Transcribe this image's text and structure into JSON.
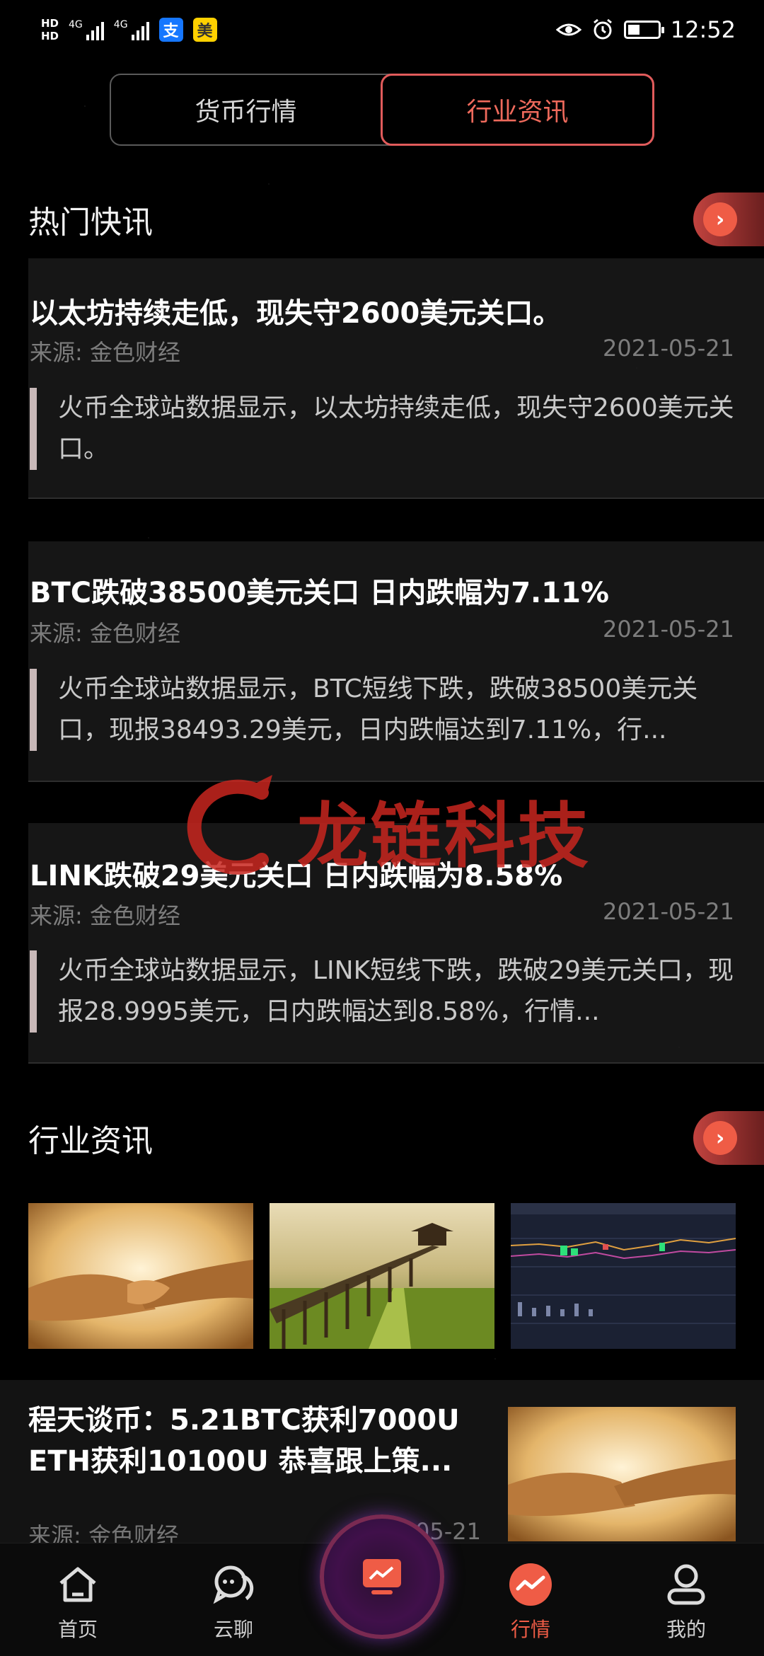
{
  "status_bar": {
    "hd1": "HD",
    "hd2": "HD",
    "net1": "4G",
    "net2": "4G",
    "app1": "支",
    "app2": "美",
    "time": "12:52",
    "battery_level": 0.4
  },
  "tabs": [
    {
      "label": "货币行情",
      "active": false
    },
    {
      "label": "行业资讯",
      "active": true
    }
  ],
  "hot_news": {
    "title": "热门快讯",
    "items": [
      {
        "title": "以太坊持续走低，现失守2600美元关口。",
        "source": "来源: 金色财经",
        "date": "2021-05-21",
        "summary": "火币全球站数据显示，以太坊持续走低，现失守2600美元关口。"
      },
      {
        "title": "BTC跌破38500美元关口 日内跌幅为7.11%",
        "source": "来源: 金色财经",
        "date": "2021-05-21",
        "summary": "火币全球站数据显示，BTC短线下跌，跌破38500美元关口，现报38493.29美元，日内跌幅达到7.11%，行..."
      },
      {
        "title": "LINK跌破29美元关口 日内跌幅为8.58%",
        "source": "来源: 金色财经",
        "date": "2021-05-21",
        "summary": "火币全球站数据显示，LINK短线下跌，跌破29美元关口，现报28.9995美元，日内跌幅达到8.58%，行情..."
      }
    ]
  },
  "watermark": {
    "text": "龙链科技"
  },
  "industry_news": {
    "title": "行业资讯",
    "article": {
      "title": "程天谈币：5.21BTC获利7000U ETH获利10100U 恭喜跟上策...",
      "source": "来源: 金色财经",
      "date": "2021-05-21"
    }
  },
  "bottom_nav": [
    {
      "label": "首页",
      "icon": "home-icon",
      "active": false
    },
    {
      "label": "云聊",
      "icon": "chat-icon",
      "active": false
    },
    {
      "label": "行情",
      "icon": "market-icon",
      "active": true
    },
    {
      "label": "我的",
      "icon": "profile-icon",
      "active": false
    }
  ],
  "colors": {
    "accent": "#ef5c46",
    "tab_active_border": "#e15b5b",
    "background": "#000000"
  }
}
